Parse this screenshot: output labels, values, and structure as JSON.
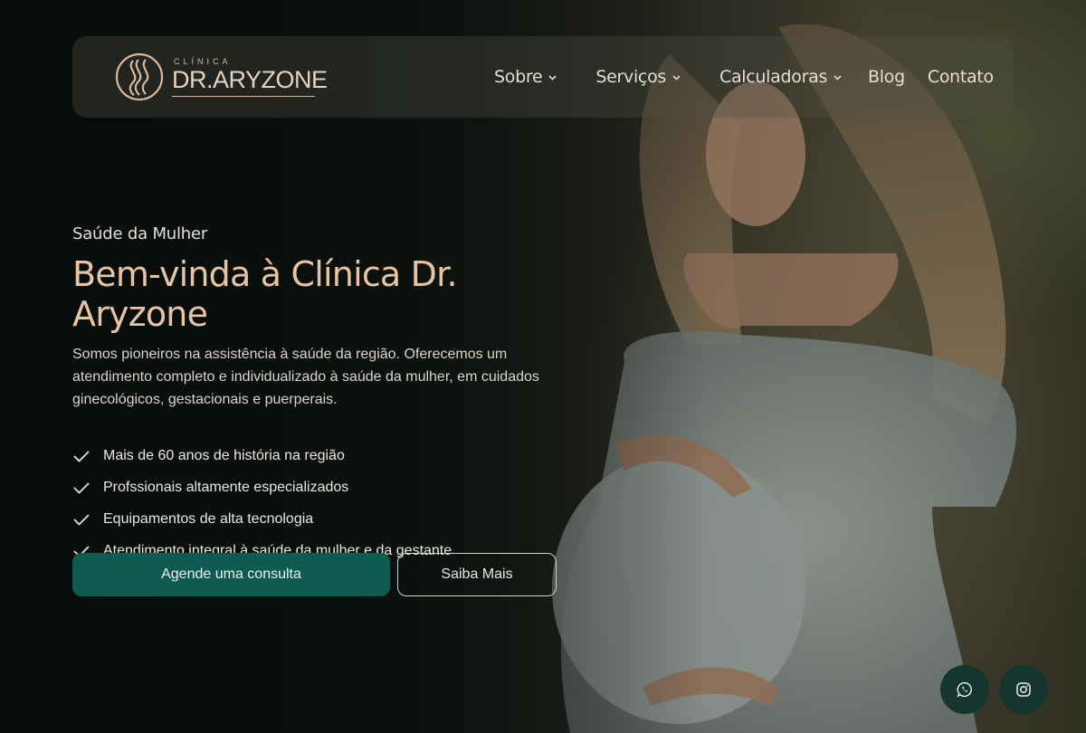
{
  "brand": {
    "small": "CLÍNICA",
    "name": "DR.ARYZONE",
    "icon": "logo-mark-icon"
  },
  "nav": {
    "items": [
      {
        "label": "Sobre",
        "has_dropdown": true
      },
      {
        "label": "Serviços",
        "has_dropdown": true
      },
      {
        "label": "Calculadoras",
        "has_dropdown": true
      },
      {
        "label": "Blog",
        "has_dropdown": false
      },
      {
        "label": "Contato",
        "has_dropdown": false
      }
    ]
  },
  "hero": {
    "eyebrow": "Saúde da Mulher",
    "title": "Bem-vinda à Clínica Dr. Aryzone",
    "description": "Somos pioneiros na assistência à saúde da região. Oferecemos um atendimento completo e individualizado à saúde da mulher, em cuidados ginecológicos, gestacionais e puerperais.",
    "features": [
      "Mais de 60 anos de história na região",
      "Profssionais altamente especializados",
      "Equipamentos de alta tecnologia",
      "Atendimento integral à saúde da mulher e da gestante"
    ],
    "primary_button": "Agende uma consulta",
    "secondary_button": "Saiba Mais"
  },
  "social": {
    "whatsapp_icon": "whatsapp-icon",
    "instagram_icon": "instagram-icon"
  },
  "colors": {
    "accent_teal": "#0f5a52",
    "title_peach": "#e6c4a6",
    "social_bg": "#17352f"
  }
}
